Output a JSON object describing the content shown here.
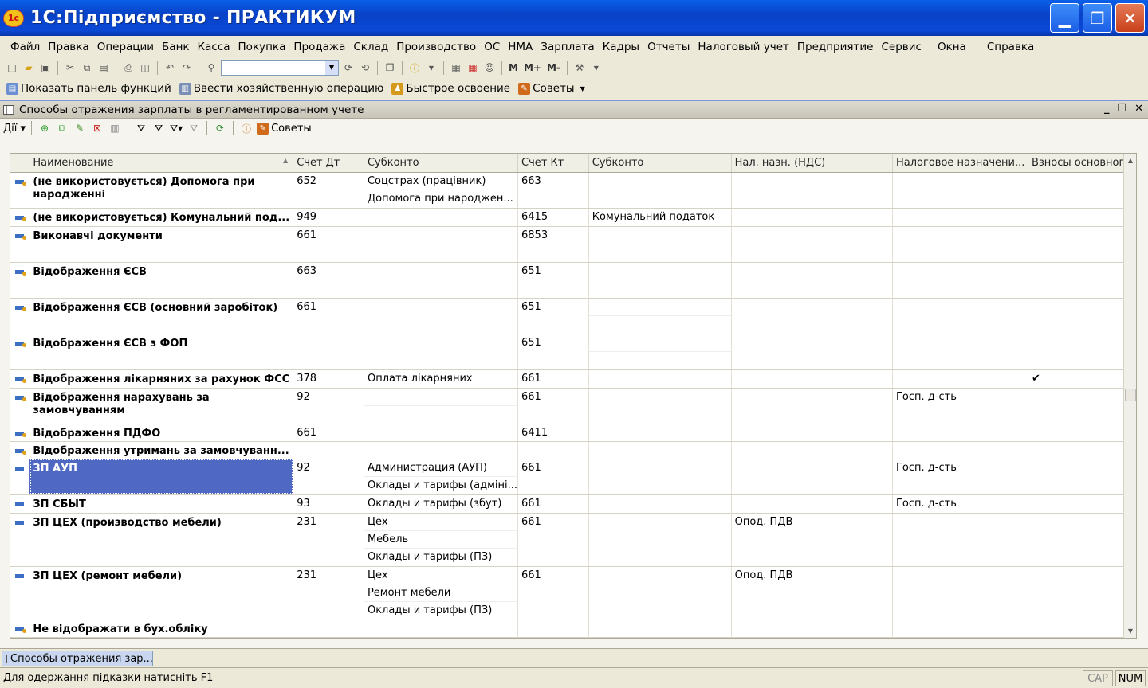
{
  "window": {
    "title": "1С:Підприємство - ПРАКТИКУМ"
  },
  "menu": [
    "Файл",
    "Правка",
    "Операции",
    "Банк",
    "Касса",
    "Покупка",
    "Продажа",
    "Склад",
    "Производство",
    "ОС",
    "НМА",
    "Зарплата",
    "Кадры",
    "Отчеты",
    "Налоговый учет",
    "Предприятие",
    "Сервис",
    "Окна",
    "Справка"
  ],
  "toolbar": {
    "m_labels": [
      "М",
      "М+",
      "М-"
    ]
  },
  "toolbar2": {
    "show_panel": "Показать панель функций",
    "enter_op": "Ввести хозяйственную операцию",
    "quick": "Быстрое освоение",
    "tips": "Советы"
  },
  "doc": {
    "title": "Способы отражения зарплаты в регламентированном учете",
    "actions_label": "Дії",
    "tips_label": "Советы"
  },
  "columns": [
    "Наименование",
    "Счет Дт",
    "Субконто",
    "Счет Кт",
    "Субконто",
    "Нал. назн. (НДС)",
    "Налоговое назначени...",
    "Взносы основног..."
  ],
  "rows": [
    {
      "name": "(не використовується) Допомога при народженні",
      "dt": "652",
      "sub_dt": [
        "Соцстрах (працівник)",
        "Допомога при народжен..."
      ],
      "kt": "663",
      "sub_kt": [],
      "vat": "",
      "tax": "",
      "contrib": "",
      "icon": "gold",
      "lines": 2
    },
    {
      "name": "(не використовується) Комунальний под...",
      "dt": "949",
      "sub_dt": [],
      "kt": "6415",
      "sub_kt": [
        "Комунальний податок"
      ],
      "vat": "",
      "tax": "",
      "contrib": "",
      "icon": "gold",
      "lines": 1
    },
    {
      "name": "Виконавчі документи",
      "dt": "661",
      "sub_dt": [],
      "kt": "6853",
      "sub_kt": [
        "",
        ""
      ],
      "vat": "",
      "tax": "",
      "contrib": "",
      "icon": "gold",
      "lines": 2
    },
    {
      "name": "Відображення ЄСВ",
      "dt": "663",
      "sub_dt": [],
      "kt": "651",
      "sub_kt": [
        "",
        ""
      ],
      "vat": "",
      "tax": "",
      "contrib": "",
      "icon": "gold",
      "lines": 2
    },
    {
      "name": "Відображення ЄСВ (основний заробіток)",
      "dt": "661",
      "sub_dt": [],
      "kt": "651",
      "sub_kt": [
        "",
        ""
      ],
      "vat": "",
      "tax": "",
      "contrib": "",
      "icon": "gold",
      "lines": 2
    },
    {
      "name": "Відображення ЄСВ з ФОП",
      "dt": "",
      "sub_dt": [],
      "kt": "651",
      "sub_kt": [
        "",
        ""
      ],
      "vat": "",
      "tax": "",
      "contrib": "",
      "icon": "gold",
      "lines": 2
    },
    {
      "name": "Відображення лікарняних за рахунок ФСС",
      "dt": "378",
      "sub_dt": [
        "Оплата лікарняних"
      ],
      "kt": "661",
      "sub_kt": [],
      "vat": "",
      "tax": "",
      "contrib": "✔",
      "icon": "gold",
      "lines": 1
    },
    {
      "name": "Відображення нарахувань за замовчуванням",
      "dt": "92",
      "sub_dt": [
        "",
        ""
      ],
      "kt": "661",
      "sub_kt": [],
      "vat": "",
      "tax": "Госп. д-сть",
      "contrib": "",
      "icon": "gold",
      "lines": 2
    },
    {
      "name": "Відображення ПДФО",
      "dt": "661",
      "sub_dt": [],
      "kt": "6411",
      "sub_kt": [],
      "vat": "",
      "tax": "",
      "contrib": "",
      "icon": "gold",
      "lines": 1
    },
    {
      "name": "Відображення утримань за замовчуванн...",
      "dt": "",
      "sub_dt": [],
      "kt": "",
      "sub_kt": [],
      "vat": "",
      "tax": "",
      "contrib": "",
      "icon": "gold",
      "lines": 1
    },
    {
      "name": "ЗП АУП",
      "dt": "92",
      "sub_dt": [
        "Администрация (АУП)",
        "Оклады и тарифы (адміні..."
      ],
      "kt": "661",
      "sub_kt": [],
      "vat": "",
      "tax": "Госп. д-сть",
      "contrib": "",
      "icon": "plain",
      "lines": 2,
      "selected": true
    },
    {
      "name": "ЗП СБЫТ",
      "dt": "93",
      "sub_dt": [
        "Оклады и тарифы  (збут)"
      ],
      "kt": "661",
      "sub_kt": [],
      "vat": "",
      "tax": "Госп. д-сть",
      "contrib": "",
      "icon": "plain",
      "lines": 1
    },
    {
      "name": "ЗП ЦЕХ (производство мебели)",
      "dt": "231",
      "sub_dt": [
        "Цех",
        "Мебель",
        "Оклады и тарифы (ПЗ)"
      ],
      "kt": "661",
      "sub_kt": [],
      "vat": "Опод. ПДВ",
      "tax": "",
      "contrib": "",
      "icon": "plain",
      "lines": 3
    },
    {
      "name": "ЗП ЦЕХ (ремонт мебели)",
      "dt": "231",
      "sub_dt": [
        "Цех",
        "Ремонт мебели",
        "Оклады и тарифы (ПЗ)"
      ],
      "kt": "661",
      "sub_kt": [],
      "vat": "Опод. ПДВ",
      "tax": "",
      "contrib": "",
      "icon": "plain",
      "lines": 3
    },
    {
      "name": "Не відображати в бух.обліку",
      "dt": "",
      "sub_dt": [],
      "kt": "",
      "sub_kt": [],
      "vat": "",
      "tax": "",
      "contrib": "",
      "icon": "gold",
      "lines": 1
    }
  ],
  "taskbar": {
    "tab": "Способы отражения зар..."
  },
  "status": {
    "hint": "Для одержання підказки натисніть F1",
    "cap": "CAP",
    "num": "NUM"
  }
}
